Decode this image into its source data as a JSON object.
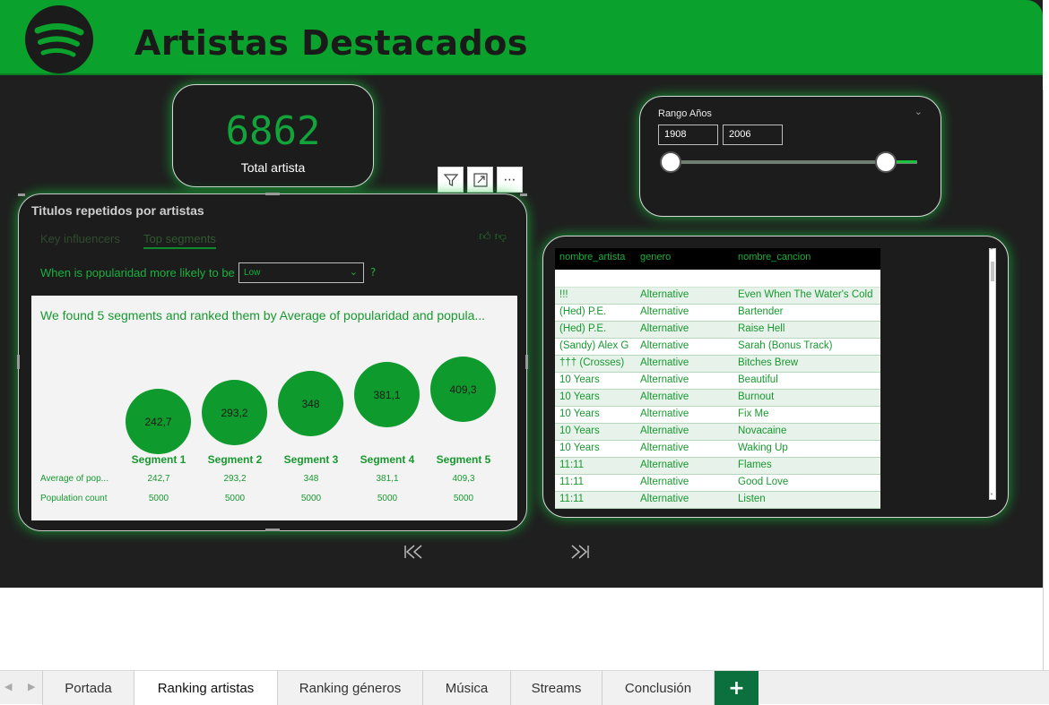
{
  "header": {
    "title": "Artistas Destacados",
    "logo_icon": "spotify-logo"
  },
  "kpi": {
    "value": "6862",
    "label": "Total artista"
  },
  "slicer": {
    "title": "Rango Años",
    "from": "1908",
    "to": "2006",
    "range_min_fraction": 0.0,
    "range_max_fraction": 1.0
  },
  "visual_toolbar": {
    "icons": [
      "filter-icon",
      "focus-mode-icon",
      "more-options-icon"
    ]
  },
  "key_influencers": {
    "title": "Titulos repetidos por artistas",
    "tabs": [
      "Key influencers",
      "Top segments"
    ],
    "active_tab": "Top segments",
    "question": "When is popularidad more likely to be",
    "selected": "Low",
    "help": "?",
    "found_text": "We found 5 segments and ranked them by Average of popularidad and popula...",
    "segments": [
      {
        "label": "Segment 1",
        "value": "242,7",
        "population": "5000"
      },
      {
        "label": "Segment 2",
        "value": "293,2",
        "population": "5000"
      },
      {
        "label": "Segment 3",
        "value": "348",
        "population": "5000"
      },
      {
        "label": "Segment 4",
        "value": "381,1",
        "population": "5000"
      },
      {
        "label": "Segment 5",
        "value": "409,3",
        "population": "5000"
      }
    ],
    "row_labels": {
      "average": "Average of pop...",
      "population": "Population count"
    }
  },
  "table": {
    "columns": [
      "nombre_artista",
      "genero",
      "nombre_cancion"
    ],
    "rows": [
      [
        "!!!",
        "Alternative",
        "Even When The Water's Cold"
      ],
      [
        "(Hed) P.E.",
        "Alternative",
        "Bartender"
      ],
      [
        "(Hed) P.E.",
        "Alternative",
        "Raise Hell"
      ],
      [
        "(Sandy) Alex G",
        "Alternative",
        "Sarah (Bonus Track)"
      ],
      [
        "††† (Crosses)",
        "Alternative",
        "Bitches Brew"
      ],
      [
        "10 Years",
        "Alternative",
        "Beautiful"
      ],
      [
        "10 Years",
        "Alternative",
        "Burnout"
      ],
      [
        "10 Years",
        "Alternative",
        "Fix Me"
      ],
      [
        "10 Years",
        "Alternative",
        "Novacaine"
      ],
      [
        "10 Years",
        "Alternative",
        "Waking Up"
      ],
      [
        "11:11",
        "Alternative",
        "Flames"
      ],
      [
        "11:11",
        "Alternative",
        "Good Love"
      ],
      [
        "11:11",
        "Alternative",
        "Listen"
      ]
    ]
  },
  "page_nav": {
    "first_icon": "first-page-icon",
    "last_icon": "last-page-icon"
  },
  "tabs": {
    "items": [
      "Portada",
      "Ranking artistas",
      "Ranking géneros",
      "Música",
      "Streams",
      "Conclusión"
    ],
    "active": "Ranking artistas",
    "add_label": "+"
  },
  "colors": {
    "brand_green": "#0aa12c",
    "text_green": "#17992f",
    "background": "#1f1f1f"
  }
}
